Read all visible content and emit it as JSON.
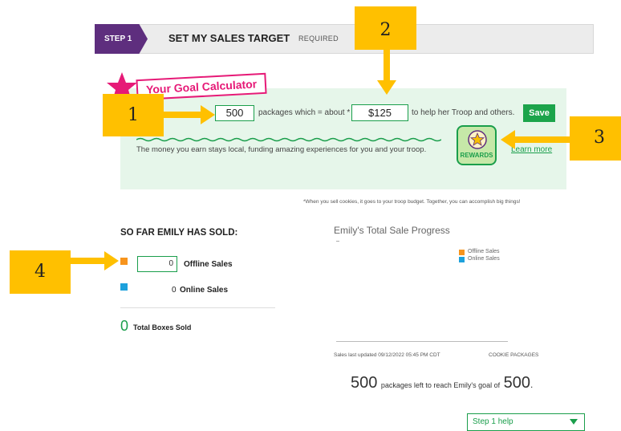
{
  "step": {
    "badge": "STEP 1",
    "title": "SET MY SALES TARGET",
    "required": "REQUIRED"
  },
  "calculator": {
    "title": "Your Goal Calculator",
    "packages_value": "500",
    "packages_text": "packages which = about *",
    "dollar_value": "$125",
    "troop_text": "to help her Troop and others.",
    "save_label": "Save",
    "money_text": "The money you earn stays local, funding amazing experiences for you and your troop.",
    "rewards_label": "REWARDS",
    "learn_more": "Learn more",
    "footnote": "*When you sell cookies, it goes to your troop budget. Together, you can accomplish big things!"
  },
  "sold": {
    "heading": "SO FAR EMILY HAS SOLD:",
    "offline_value": "0",
    "offline_label": "Offline Sales",
    "online_value": "0",
    "online_label": "Online Sales",
    "total_value": "0",
    "total_label": "Total Boxes Sold"
  },
  "chart": {
    "title": "Emily's Total Sale Progress",
    "legend_offline": "Offline Sales",
    "legend_online": "Online Sales",
    "updated": "Sales last updated 09/12/2022 05:45 PM CDT",
    "cookie_packages": "COOKIE PACKAGES",
    "left_count": "500",
    "left_text": "packages left to reach Emily's goal of",
    "left_goal": "500",
    "left_period": "."
  },
  "help": {
    "label": "Step 1 help",
    "icon": "chevron-down-icon"
  },
  "callouts": [
    "1",
    "2",
    "3",
    "4"
  ],
  "colors": {
    "step_purple": "#5e2e7e",
    "brand_green": "#1ca44b",
    "panel_green": "#e6f6ea",
    "accent_pink": "#e61a77",
    "offline_orange": "#f7941d",
    "online_blue": "#1da1dc",
    "callout_yellow": "#ffc000"
  }
}
